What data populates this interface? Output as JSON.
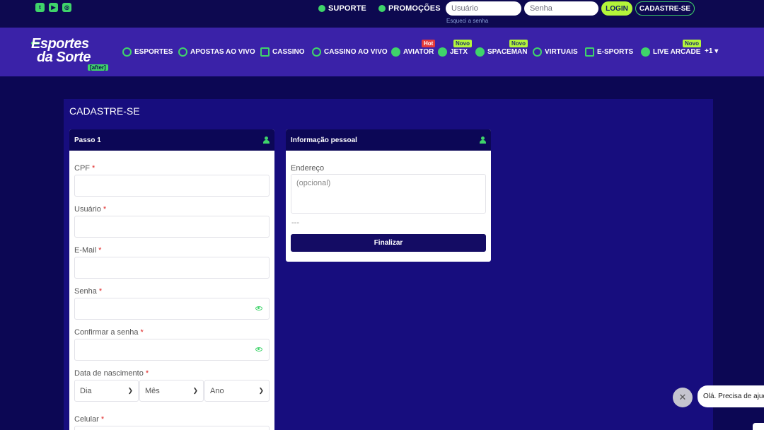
{
  "topbar": {
    "social_icons": [
      "twitter-icon",
      "youtube-icon",
      "instagram-icon"
    ],
    "suporte_label": "SUPORTE",
    "promocoes_label": "PROMOÇÕES",
    "usuario_placeholder": "Usuário",
    "senha_placeholder": "Senha",
    "forgot_label": "Esqueci a senha",
    "login_label": "LOGIN",
    "cadastre_label": "CADASTRE-SE"
  },
  "brand": {
    "line1": "Esportes",
    "line2": "da Sorte",
    "badge": "[after]"
  },
  "nav": {
    "items": [
      {
        "label": "ESPORTES"
      },
      {
        "label": "APOSTAS AO VIVO"
      },
      {
        "label": "CASSINO"
      },
      {
        "label": "CASSINO AO VIVO"
      },
      {
        "label": "AVIATOR",
        "tag": "Hot"
      },
      {
        "label": "JETX",
        "tag": "Novo"
      },
      {
        "label": "SPACEMAN",
        "tag": "Novo"
      },
      {
        "label": "VIRTUAIS"
      },
      {
        "label": "E-SPORTS"
      },
      {
        "label": "LIVE ARCADE",
        "tag": "Novo"
      }
    ],
    "more_label": "+1"
  },
  "page": {
    "title": "CADASTRE-SE"
  },
  "step1": {
    "title": "Passo 1",
    "cpf_label": "CPF",
    "usuario_label": "Usuário",
    "email_label": "E-Mail",
    "senha_label": "Senha",
    "confirmar_label": "Confirmar a senha",
    "nascimento_label": "Data de nascimento",
    "dia_value": "Dia",
    "mes_value": "Mês",
    "ano_value": "Ano",
    "celular_label": "Celular",
    "required_mark": "*"
  },
  "personal": {
    "title": "Informação pessoal",
    "endereco_label": "Endereço",
    "endereco_placeholder": "(opcional)",
    "dashes": "---",
    "finalizar_label": "Finalizar"
  },
  "chat": {
    "close_symbol": "✕",
    "message": "Olá. Precisa de ajuda?"
  },
  "colors": {
    "background": "#0c0754",
    "nav": "#3a22a8",
    "accent": "#3fd46a",
    "lime": "#b4f53a",
    "panel": "#170d7e"
  }
}
